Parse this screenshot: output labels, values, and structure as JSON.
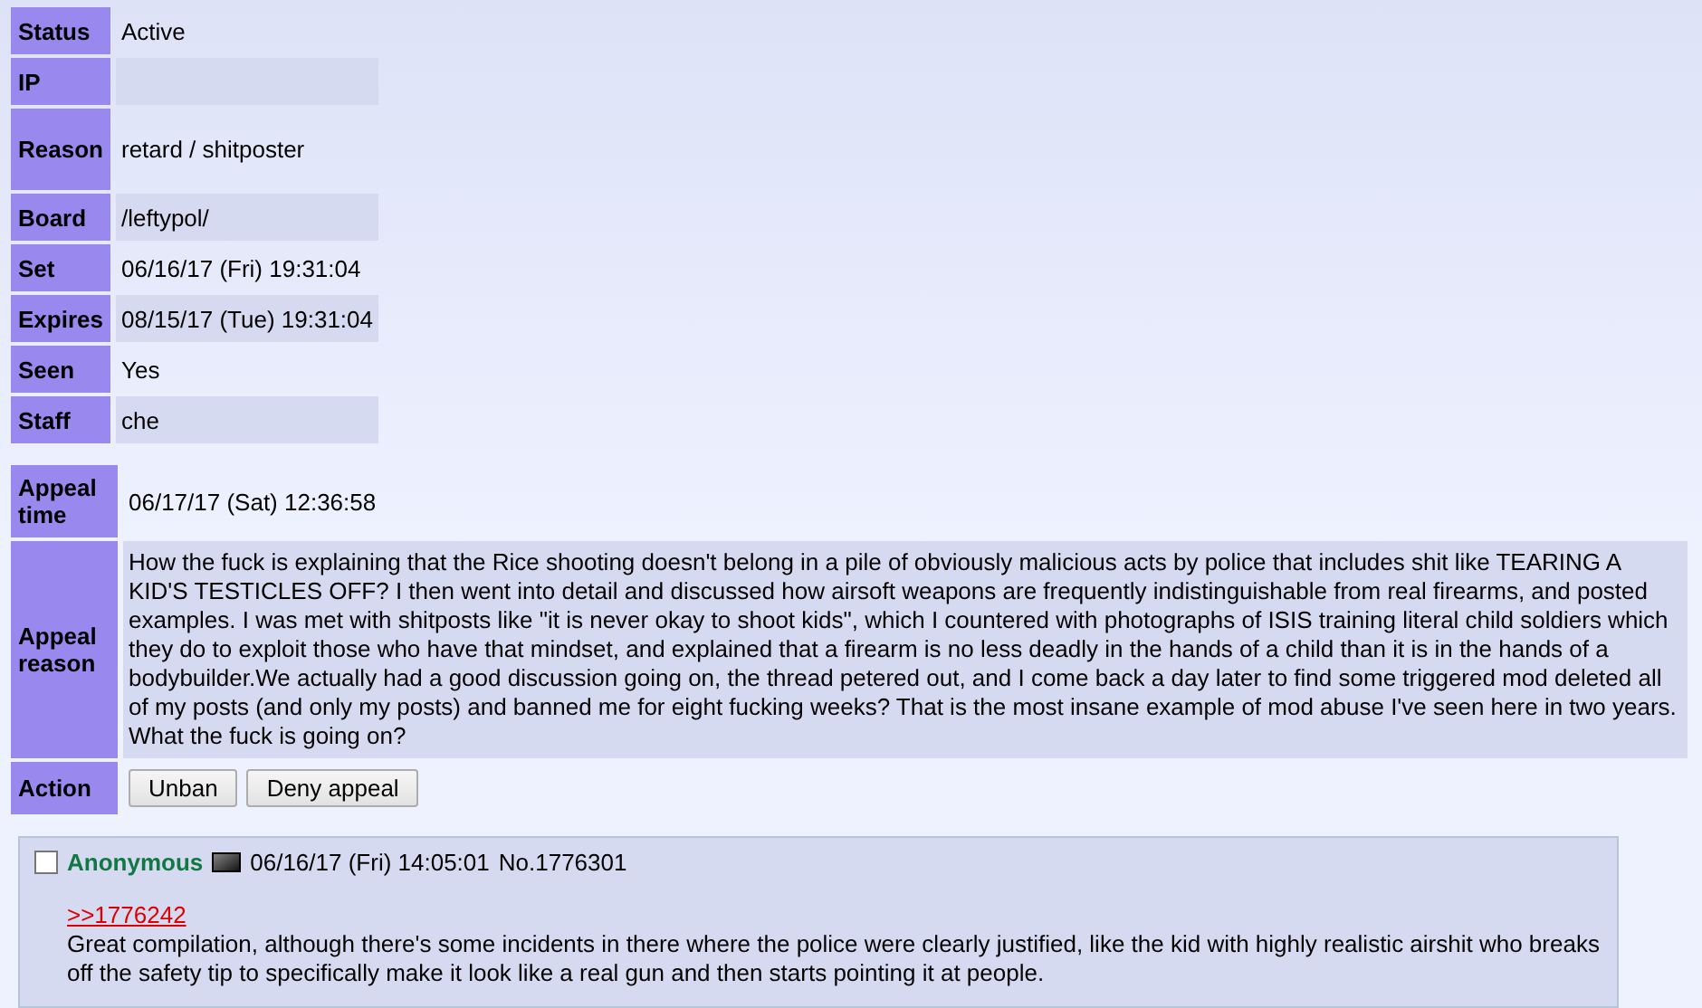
{
  "ban_details": [
    {
      "label": "Status",
      "value": "Active"
    },
    {
      "label": "IP"
    },
    {
      "label": "Reason",
      "value": "retard / shitposter"
    },
    {
      "label": "Board",
      "value": "/leftypol/"
    },
    {
      "label": "Set",
      "value": "06/16/17 (Fri) 19:31:04"
    },
    {
      "label": "Expires",
      "value": "08/15/17 (Tue) 19:31:04"
    },
    {
      "label": "Seen",
      "value": "Yes"
    },
    {
      "label": "Staff",
      "value": "che"
    }
  ],
  "appeal": {
    "time_label": "Appeal time",
    "time": "06/17/17 (Sat) 12:36:58",
    "reason_label": "Appeal reason",
    "reason": "How the fuck is explaining that the Rice shooting doesn't belong in a pile of obviously malicious acts by police that includes shit like TEARING A KID'S TESTICLES OFF? I then went into detail and discussed how airsoft weapons are frequently indistinguishable from real firearms, and posted examples. I was met with shitposts like \"it is never okay to shoot kids\", which I countered with photographs of ISIS training literal child soldiers which they do to exploit those who have that mindset, and explained that a firearm is no less deadly in the hands of a child than it is in the hands of a bodybuilder.We actually had a good discussion going on, the thread petered out, and I come back a day later to find some triggered mod deleted all of my posts (and only my posts) and banned me for eight fucking weeks? That is the most insane example of mod abuse I've seen here in two years. What the fuck is going on?",
    "action_label": "Action",
    "actions": [
      "Unban",
      "Deny appeal"
    ]
  },
  "post": {
    "checked": false,
    "name": "Anonymous",
    "date": "06/16/17 (Fri) 14:05:01",
    "number": "No.1776301",
    "reply_link": ">>1776242",
    "body": "Great compilation, although there's some incidents in there where the police were clearly justified, like the kid with highly realistic airshit who breaks off the safety tip to specifically make it look like a real gun and then starts pointing it at people."
  }
}
